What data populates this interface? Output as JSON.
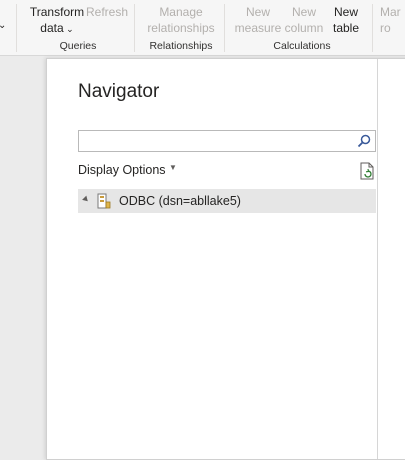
{
  "ribbon": {
    "transform": {
      "line1": "Transform",
      "line2": "data"
    },
    "refresh": "Refresh",
    "manage_rel": {
      "line1": "Manage",
      "line2": "relationships"
    },
    "new_measure": {
      "line1": "New",
      "line2": "measure"
    },
    "new_column": {
      "line1": "New",
      "line2": "column"
    },
    "new_table": {
      "line1": "New",
      "line2": "table"
    },
    "partial_right": {
      "line1": "Mar",
      "line2": "ro"
    },
    "groups": {
      "queries": "Queries",
      "relationships": "Relationships",
      "calculations": "Calculations"
    }
  },
  "navigator": {
    "title": "Navigator",
    "search_value": "",
    "display_options": "Display Options",
    "tree": [
      {
        "label": "ODBC (dsn=abllake5)"
      }
    ]
  },
  "icons": {
    "search": "search-icon",
    "refresh": "refresh-document-icon",
    "database": "database-icon",
    "expand": "expand-triangle-icon",
    "chevron": "chevron-down-icon"
  }
}
